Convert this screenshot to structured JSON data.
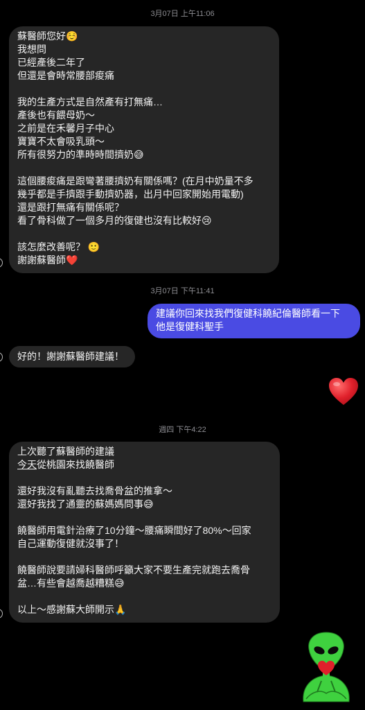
{
  "timestamps": {
    "t1": "3月07日 上午11:06",
    "t2": "3月07日 下午11:41",
    "t3": "週四 下午4:22"
  },
  "messages": {
    "m1": {
      "sender": "incoming",
      "lines": [
        "蘇醫師您好☺️",
        "我想問",
        "已經產後二年了",
        "但還是會時常腰部痠痛",
        "",
        "我的生產方式是自然產有打無痛…",
        "產後也有餵母奶～",
        "之前是在禾馨月子中心",
        "寶寶不太會吸乳頭～",
        "所有很努力的準時時間擠奶😅",
        "",
        "這個腰痠痛是跟彎著腰擠奶有關係嗎？(在月中奶量不多",
        "幾乎都是手擠跟手動擠奶器，出月中回家開始用電動)",
        "還是跟打無痛有關係呢？",
        "看了骨科做了一個多月的復健也沒有比較好😢",
        "",
        "該怎麼改善呢？ 🙂",
        "謝謝蘇醫師❤️"
      ]
    },
    "m2": {
      "sender": "outgoing",
      "lines": [
        "建議你回來找我們復健科饒紀倫醫師看一下",
        "他是復健科聖手"
      ]
    },
    "m3": {
      "sender": "incoming",
      "text": "好的！謝謝蘇醫師建議！"
    },
    "m4": {
      "sender": "outgoing",
      "emoji": "❤️"
    },
    "m5": {
      "sender": "incoming",
      "line1": "上次聽了蘇醫師的建議",
      "line2_underlined": "今天",
      "line2_rest": "從桃園來找饒醫師",
      "lines_after": [
        "",
        "還好我沒有亂聽去找喬骨盆的推拿～",
        "還好我找了通靈的蘇媽媽問事😅",
        "",
        "饒醫師用電針治療了10分鐘～腰痛瞬間好了80%～回家",
        "自己運動復健就沒事了！",
        "",
        "饒醫師說要請婦科醫師呼籲大家不要生產完就跑去喬骨",
        "盆…有些會越喬越糟糕😅",
        "",
        "以上～感謝蘇大師開示🙏"
      ]
    },
    "m6": {
      "sender": "outgoing",
      "sticker": "alien-heart-sticker"
    }
  },
  "colors": {
    "incoming_bubble": "#262626",
    "outgoing_bubble": "#4a4be3",
    "timestamp": "#8e8e93",
    "heart": "#e0202b",
    "alien": "#3fd13f"
  }
}
